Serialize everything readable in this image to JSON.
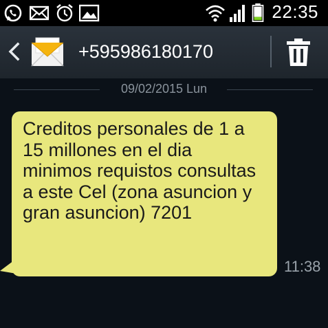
{
  "status_bar": {
    "time": "22:35",
    "icons": [
      "whatsapp-icon",
      "email-icon",
      "alarm-icon",
      "gallery-icon",
      "wifi-icon",
      "signal-icon",
      "battery-icon"
    ]
  },
  "header": {
    "contact": "+595986180170",
    "icons": [
      "back-icon",
      "envelope-icon",
      "trash-icon"
    ]
  },
  "conversation": {
    "date_separator": "09/02/2015 Lun",
    "messages": [
      {
        "text": "Creditos personales de 1 a 15 millones en el dia minimos requistos consultas a este Cel (zona asuncion y gran asuncion) 7201",
        "time": "11:38"
      }
    ]
  },
  "colors": {
    "background": "#0b1118",
    "bubble": "#e8e77d",
    "header": "#252c33",
    "text_muted": "#8a939c"
  }
}
